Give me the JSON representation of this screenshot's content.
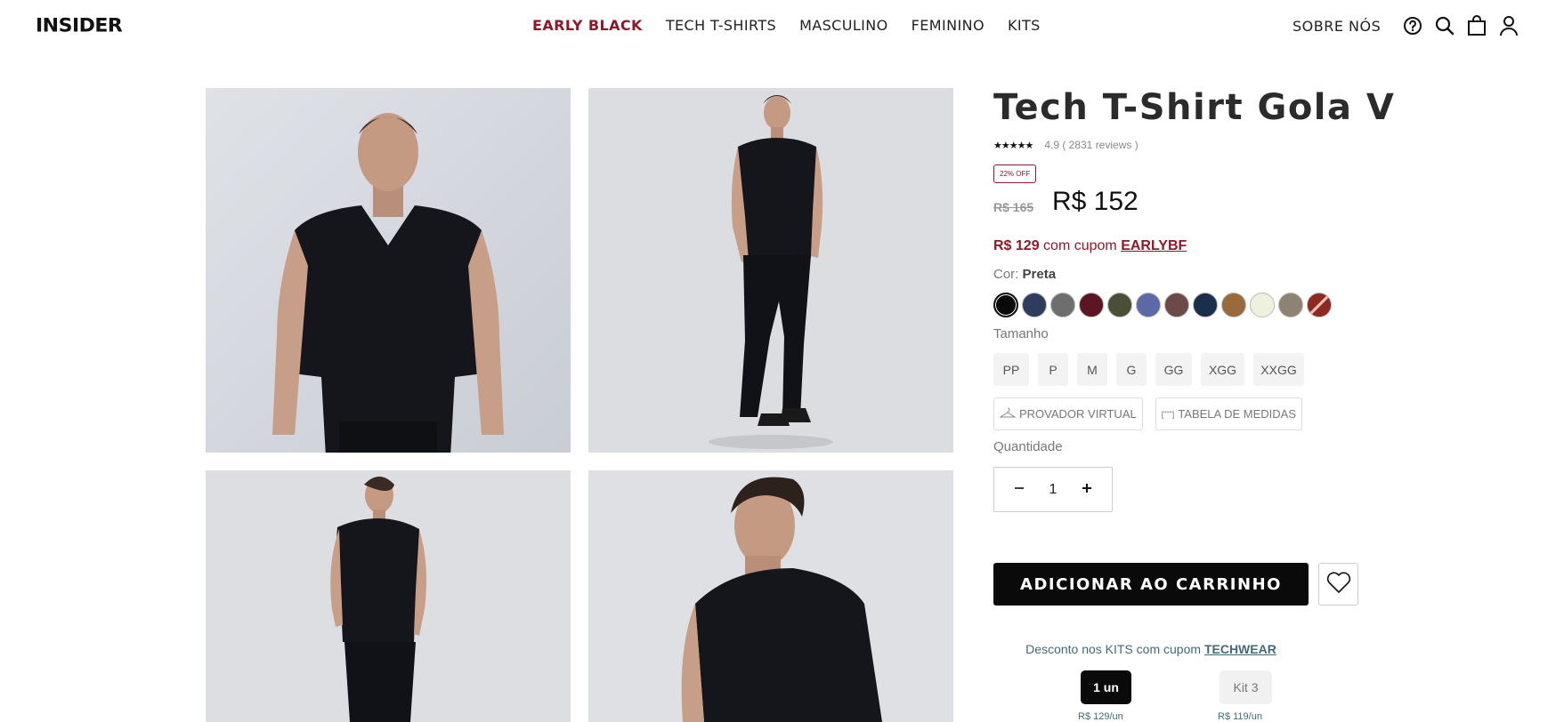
{
  "header": {
    "logo": "INSIDER",
    "nav": [
      "EARLY BLACK",
      "TECH T-SHIRTS",
      "MASCULINO",
      "FEMININO",
      "KITS"
    ],
    "about": "SOBRE NÓS",
    "icons": [
      "help-icon",
      "search-icon",
      "bag-icon",
      "user-icon"
    ]
  },
  "product": {
    "title": "Tech T-Shirt Gola V",
    "stars": "★★★★★",
    "rating_text": "4.9  ( 2831 reviews )",
    "discount_badge": "22% OFF",
    "old_price": "R$ 165",
    "new_price": "R$ 152",
    "coupon_price": "R$ 129",
    "coupon_text": " com cupom ",
    "coupon_code": "EARLYBF",
    "color_label": "Cor: ",
    "color_value": "Preta",
    "colors": [
      "#0a0a0a",
      "#2e3c5e",
      "#6d6e6d",
      "#5c1623",
      "#4b4f36",
      "#5b6aa7",
      "#6b4a48",
      "#1b2e4b",
      "#9a6a3c",
      "#eef2dc",
      "#8e8273",
      "#8e2a22"
    ],
    "size_label": "Tamanho",
    "sizes": [
      "PP",
      "P",
      "M",
      "G",
      "GG",
      "XGG",
      "XXGG"
    ],
    "tool_virtual": "PROVADOR VIRTUAL",
    "tool_measures": "TABELA DE MEDIDAS",
    "tool_measures_icon": "[\"\"\"]",
    "quantity_label": "Quantidade",
    "quantity": "1",
    "add_to_cart": "ADICIONAR AO CARRINHO",
    "kits_text": "Desconto nos KITS com cupom ",
    "kits_code": "TECHWEAR",
    "kit_options": [
      {
        "label": "1 un",
        "price": "R$ 129/un"
      },
      {
        "label": "Kit 3",
        "price": "R$ 119/un"
      }
    ]
  },
  "accent_color": "#8b1a2b"
}
